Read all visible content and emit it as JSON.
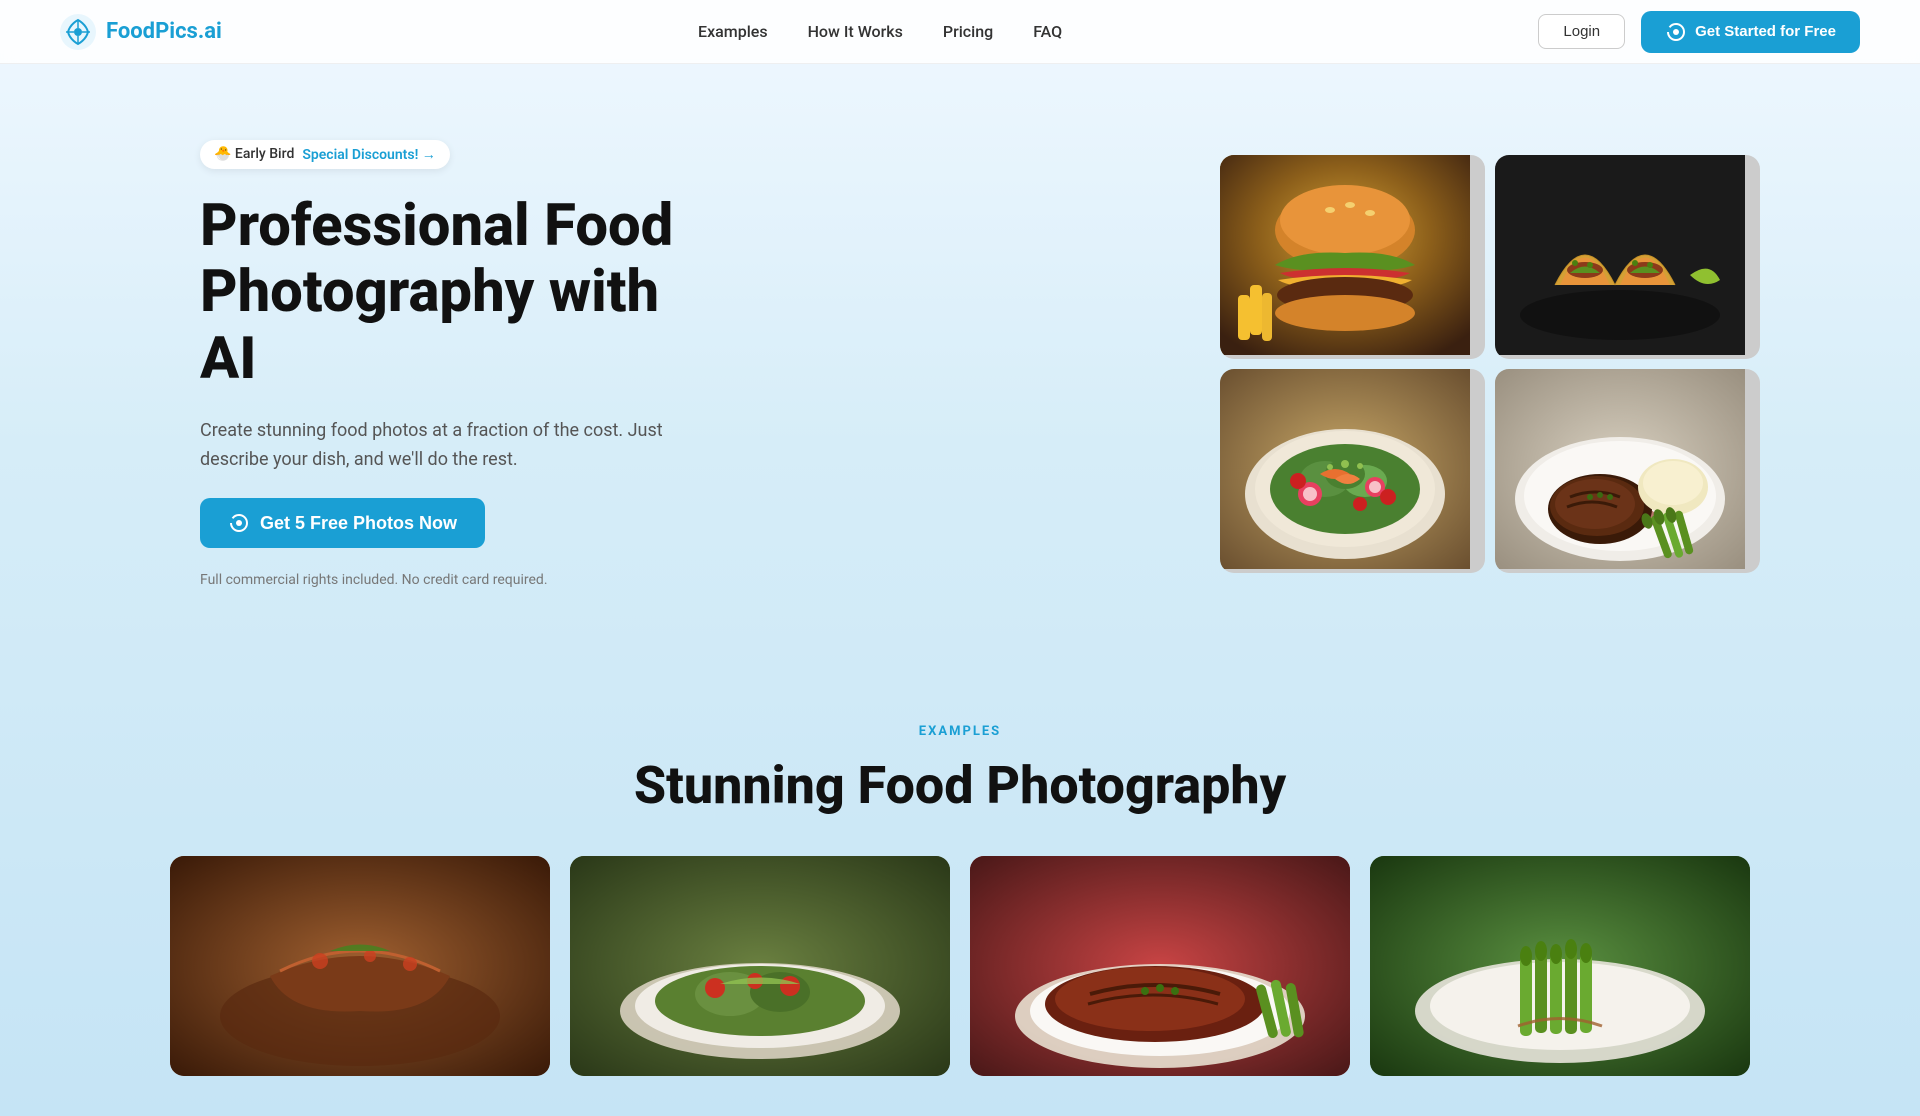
{
  "brand": {
    "name": "FoodPics.ai",
    "logo_alt": "FoodPics AI Logo"
  },
  "navbar": {
    "links": [
      {
        "id": "examples",
        "label": "Examples"
      },
      {
        "id": "how-it-works",
        "label": "How It Works"
      },
      {
        "id": "pricing",
        "label": "Pricing"
      },
      {
        "id": "faq",
        "label": "FAQ"
      }
    ],
    "login_label": "Login",
    "cta_label": "Get Started for Free"
  },
  "hero": {
    "badge_early_bird": "🐣 Early Bird",
    "badge_discount": "Special Discounts! →",
    "title_line1": "Professional Food",
    "title_line2": "Photography with AI",
    "subtitle": "Create stunning food photos at a fraction of the cost. Just describe your dish, and we'll do the rest.",
    "cta_label": "Get 5 Free Photos Now",
    "disclaimer": "Full commercial rights included. No credit card required."
  },
  "examples_section": {
    "label": "EXAMPLES",
    "title": "Stunning Food Photography"
  },
  "footer": {}
}
